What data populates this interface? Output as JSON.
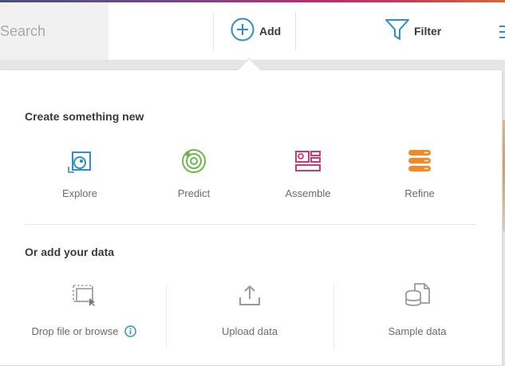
{
  "toolbar": {
    "search_placeholder": "Search",
    "add_label": "Add",
    "filter_label": "Filter"
  },
  "popover": {
    "create_title": "Create something new",
    "create_items": [
      {
        "label": "Explore",
        "icon": "explore-icon",
        "color": "#2d8fc4"
      },
      {
        "label": "Predict",
        "icon": "predict-icon",
        "color": "#6bb84a"
      },
      {
        "label": "Assemble",
        "icon": "assemble-icon",
        "color": "#d4386e"
      },
      {
        "label": "Refine",
        "icon": "refine-icon",
        "color": "#f08a24"
      }
    ],
    "data_title": "Or add your data",
    "data_items": [
      {
        "label": "Drop file or browse",
        "icon": "drop-file-icon"
      },
      {
        "label": "Upload data",
        "icon": "upload-icon"
      },
      {
        "label": "Sample data",
        "icon": "sample-data-icon"
      }
    ]
  },
  "colors": {
    "accent": "#2d8fc4",
    "text": "#3a3a3a",
    "muted": "#6b6b6b"
  }
}
